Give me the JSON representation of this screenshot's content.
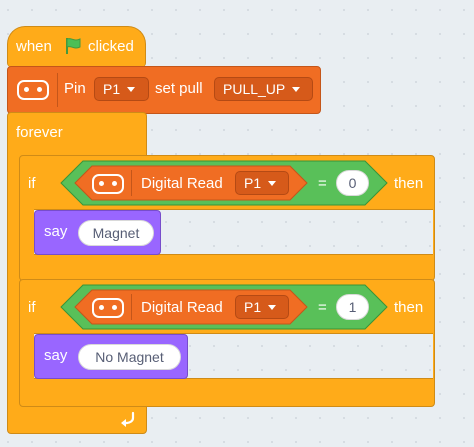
{
  "hat": {
    "label_when": "when",
    "label_clicked": "clicked",
    "flag_icon": "green-flag-icon",
    "color": "#ffab19"
  },
  "pin_block": {
    "label_pin": "Pin",
    "pin_value": "P1",
    "label_set_pull": "set pull",
    "pull_value": "PULL_UP",
    "color": "#f06d23"
  },
  "forever": {
    "label": "forever",
    "loop_icon": "loop-arrow-icon"
  },
  "if_blocks": [
    {
      "if_label": "if",
      "sensor_label": "Digital Read",
      "pin_value": "P1",
      "operator": "=",
      "compare_value": "0",
      "then_label": "then",
      "say_label": "say",
      "say_value": "Magnet"
    },
    {
      "if_label": "if",
      "sensor_label": "Digital Read",
      "pin_value": "P1",
      "operator": "=",
      "compare_value": "1",
      "then_label": "then",
      "say_label": "say",
      "say_value": "No Magnet"
    }
  ],
  "colors": {
    "events": "#ffab19",
    "pins": "#f06d23",
    "operators": "#59c059",
    "looks": "#9966ff",
    "background": "#e9eef2"
  }
}
